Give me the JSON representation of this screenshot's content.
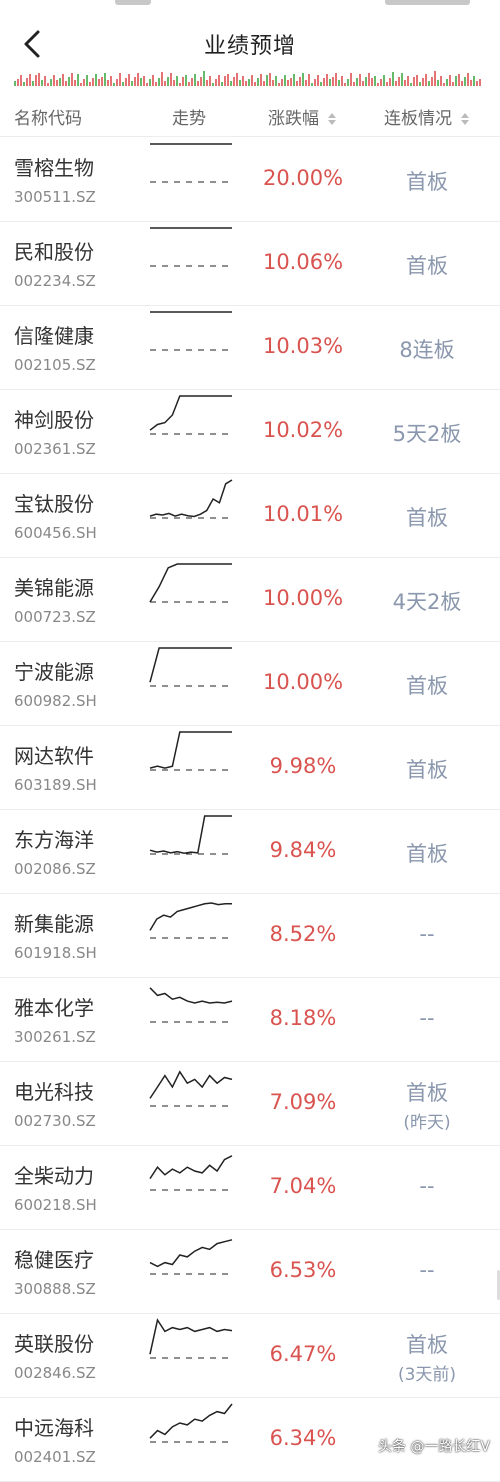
{
  "header": {
    "title": "业绩预增"
  },
  "columns": {
    "name": "名称代码",
    "trend": "走势",
    "change": "涨跌幅",
    "streak": "连板情况"
  },
  "colors": {
    "up": "#d9534f",
    "streak": "#8a97ad",
    "vol_red": "#e57373",
    "vol_green": "#66bb6a"
  },
  "stocks": [
    {
      "name": "雪榕生物",
      "code": "300511.SZ",
      "change": "20.00%",
      "streak": "首板",
      "streak_note": "",
      "trend": [
        1,
        1,
        1,
        1,
        1,
        1,
        1,
        1,
        1,
        1
      ]
    },
    {
      "name": "民和股份",
      "code": "002234.SZ",
      "change": "10.06%",
      "streak": "首板",
      "streak_note": "",
      "trend": [
        1,
        1,
        1,
        1,
        1,
        1,
        1,
        1,
        1,
        1
      ]
    },
    {
      "name": "信隆健康",
      "code": "002105.SZ",
      "change": "10.03%",
      "streak": "8连板",
      "streak_note": "",
      "trend": [
        1,
        1,
        1,
        1,
        1,
        1,
        1,
        1,
        1,
        1
      ]
    },
    {
      "name": "神剑股份",
      "code": "002361.SZ",
      "change": "10.02%",
      "streak": "5天2板",
      "streak_note": "",
      "trend": [
        0.1,
        0.25,
        0.3,
        0.5,
        1,
        1,
        1,
        1,
        1,
        1,
        1,
        1
      ]
    },
    {
      "name": "宝钛股份",
      "code": "600456.SH",
      "change": "10.01%",
      "streak": "首板",
      "streak_note": "",
      "trend": [
        0.05,
        0.1,
        0.08,
        0.12,
        0.05,
        0.1,
        0.06,
        0.04,
        0.1,
        0.2,
        0.5,
        0.4,
        0.9,
        1
      ]
    },
    {
      "name": "美锦能源",
      "code": "000723.SZ",
      "change": "10.00%",
      "streak": "4天2板",
      "streak_note": "",
      "trend": [
        0,
        0.4,
        0.9,
        1,
        1,
        1,
        1,
        1,
        1,
        1
      ]
    },
    {
      "name": "宁波能源",
      "code": "600982.SH",
      "change": "10.00%",
      "streak": "首板",
      "streak_note": "",
      "trend": [
        0.1,
        1,
        1,
        1,
        1,
        1,
        1,
        1,
        1,
        1
      ]
    },
    {
      "name": "网达软件",
      "code": "603189.SH",
      "change": "9.98%",
      "streak": "首板",
      "streak_note": "",
      "trend": [
        0.05,
        0.1,
        0.05,
        0.1,
        1,
        1,
        1,
        1,
        1,
        1,
        1,
        1
      ]
    },
    {
      "name": "东方海洋",
      "code": "002086.SZ",
      "change": "9.84%",
      "streak": "首板",
      "streak_note": "",
      "trend": [
        0.1,
        0.05,
        0.08,
        0.03,
        0.06,
        0.02,
        0.05,
        0.03,
        1,
        1,
        1,
        1,
        1
      ]
    },
    {
      "name": "新集能源",
      "code": "601918.SH",
      "change": "8.52%",
      "streak": "--",
      "streak_note": "",
      "trend": [
        0.2,
        0.5,
        0.6,
        0.55,
        0.7,
        0.75,
        0.8,
        0.85,
        0.9,
        0.92,
        0.88,
        0.9,
        0.9
      ]
    },
    {
      "name": "雅本化学",
      "code": "300261.SZ",
      "change": "8.18%",
      "streak": "--",
      "streak_note": "",
      "trend": [
        0.9,
        0.7,
        0.75,
        0.6,
        0.65,
        0.55,
        0.5,
        0.55,
        0.5,
        0.52,
        0.5,
        0.55
      ]
    },
    {
      "name": "电光科技",
      "code": "002730.SZ",
      "change": "7.09%",
      "streak": "首板",
      "streak_note": "(昨天)",
      "trend": [
        0.2,
        0.5,
        0.8,
        0.5,
        0.9,
        0.6,
        0.7,
        0.5,
        0.8,
        0.6,
        0.75,
        0.7
      ]
    },
    {
      "name": "全柴动力",
      "code": "600218.SH",
      "change": "7.04%",
      "streak": "--",
      "streak_note": "",
      "trend": [
        0.3,
        0.6,
        0.4,
        0.55,
        0.45,
        0.6,
        0.5,
        0.45,
        0.65,
        0.5,
        0.8,
        0.9
      ]
    },
    {
      "name": "稳健医疗",
      "code": "300888.SZ",
      "change": "6.53%",
      "streak": "--",
      "streak_note": "",
      "trend": [
        0.3,
        0.2,
        0.3,
        0.25,
        0.5,
        0.45,
        0.6,
        0.7,
        0.65,
        0.8,
        0.85,
        0.9
      ]
    },
    {
      "name": "英联股份",
      "code": "002846.SZ",
      "change": "6.47%",
      "streak": "首板",
      "streak_note": "(3天前)",
      "trend": [
        0.1,
        1,
        0.7,
        0.8,
        0.75,
        0.8,
        0.7,
        0.75,
        0.8,
        0.7,
        0.75,
        0.72
      ]
    },
    {
      "name": "中远海科",
      "code": "002401.SZ",
      "change": "6.34%",
      "streak": "",
      "streak_note": "",
      "trend": [
        0.1,
        0.3,
        0.2,
        0.4,
        0.5,
        0.45,
        0.6,
        0.55,
        0.7,
        0.8,
        0.75,
        1
      ]
    }
  ],
  "watermark": "头条 @一路长红V"
}
